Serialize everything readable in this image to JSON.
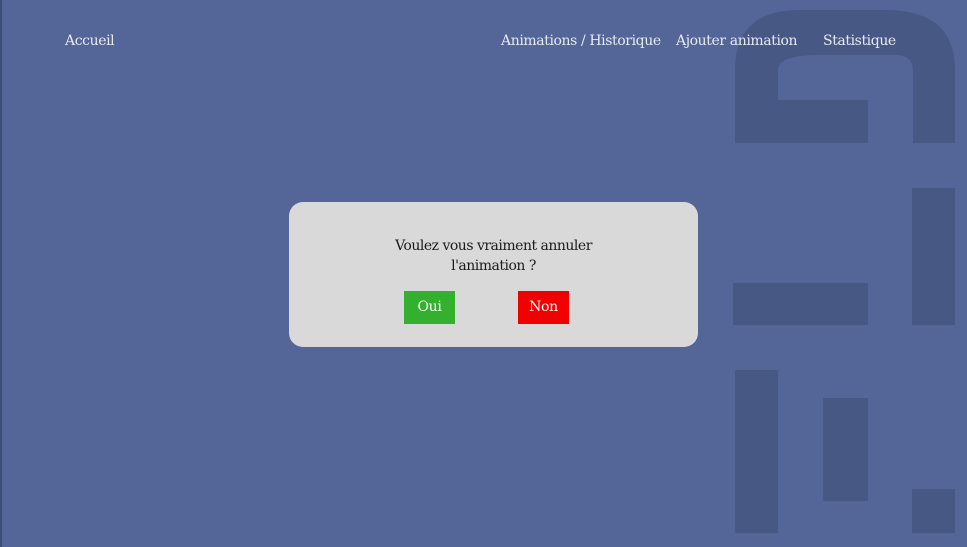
{
  "nav": {
    "home_label": "Accueil",
    "history_label": "Animations / Historique",
    "add_label": "Ajouter animation",
    "stats_label": "Statistique"
  },
  "dialog": {
    "message_line1": "Voulez vous vraiment annuler",
    "message_line2": "l'animation ?",
    "yes_label": "Oui",
    "no_label": "Non"
  },
  "colors": {
    "background": "#546597",
    "decor": "#485885",
    "dialog_background": "#d9d9d9",
    "yes_button": "#32b02e",
    "no_button": "#f10000"
  }
}
